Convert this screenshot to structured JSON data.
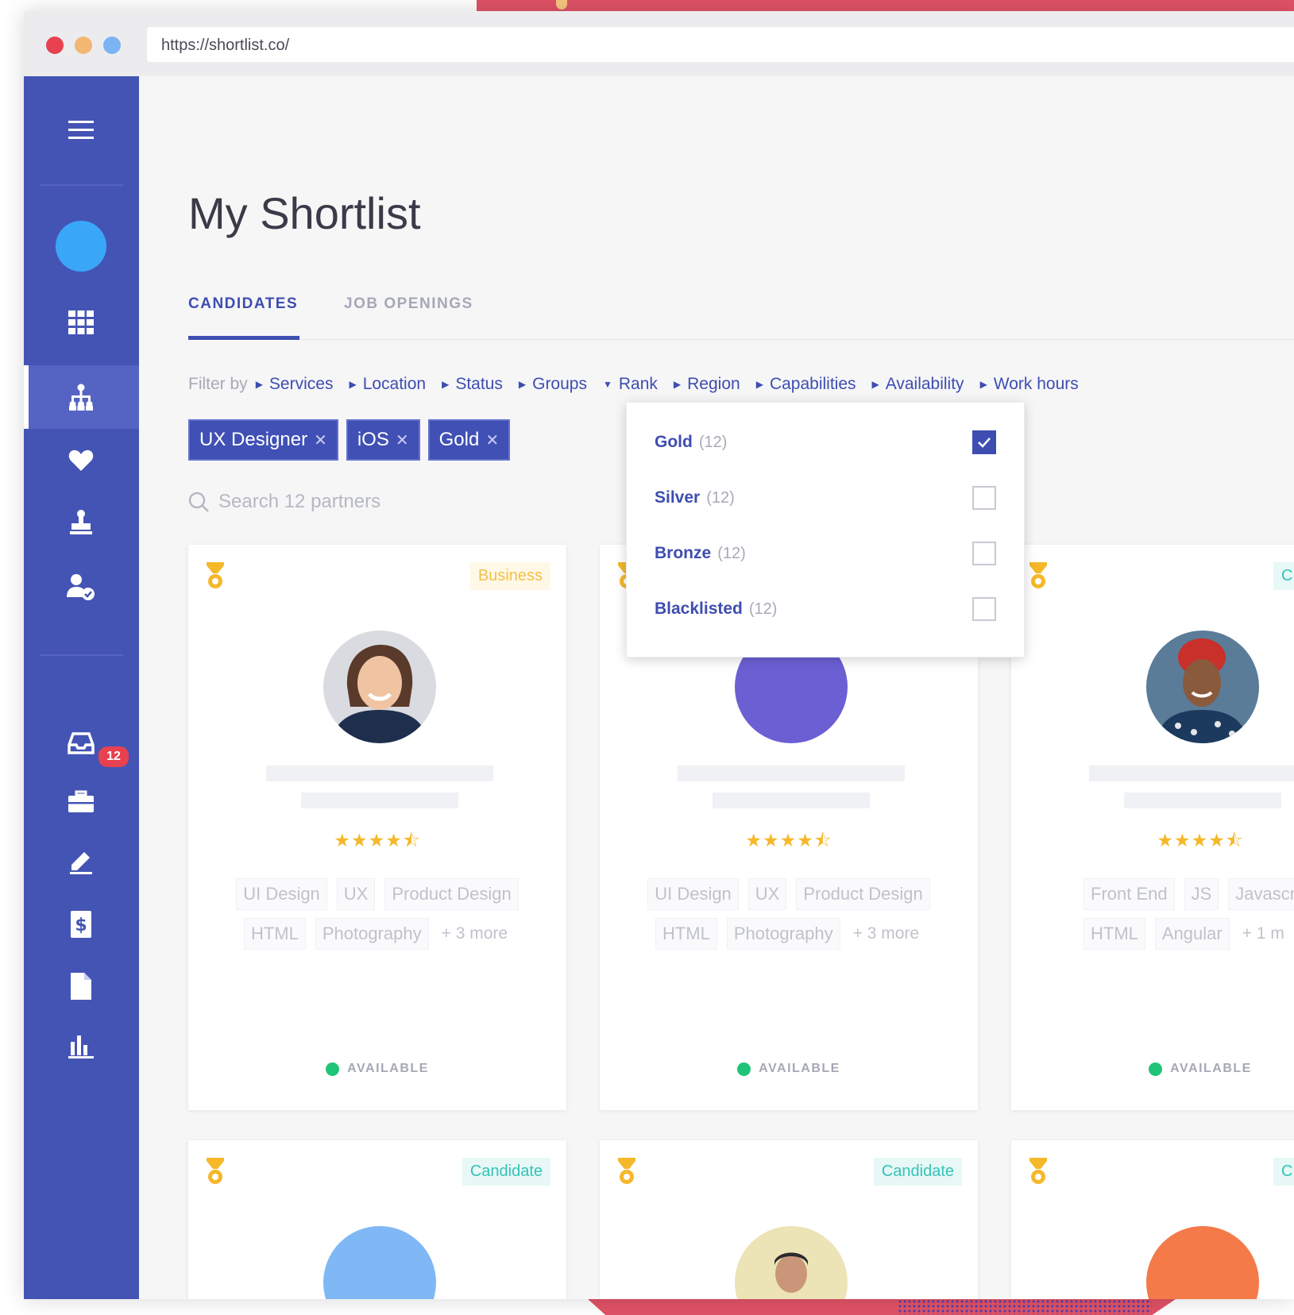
{
  "browser": {
    "url": "https://shortlist.co/"
  },
  "sidebar": {
    "notification_count": "12",
    "icons": [
      "menu-icon",
      "avatar",
      "grid-icon",
      "org-chart-icon",
      "heart-icon",
      "stamp-icon",
      "user-check-icon",
      "inbox-icon",
      "briefcase-icon",
      "pencil-icon",
      "dollar-document-icon",
      "file-icon",
      "bar-chart-icon"
    ]
  },
  "page": {
    "title": "My Shortlist"
  },
  "tabs": [
    {
      "label": "CANDIDATES",
      "active": true
    },
    {
      "label": "JOB OPENINGS",
      "active": false
    }
  ],
  "filters": {
    "label": "Filter by",
    "items": [
      "Services",
      "Location",
      "Status",
      "Groups",
      "Rank",
      "Region",
      "Capabilities",
      "Availability",
      "Work hours"
    ],
    "open_item": "Rank"
  },
  "chips": [
    "UX Designer",
    "iOS",
    "Gold"
  ],
  "search": {
    "placeholder": "Search 12 partners"
  },
  "rank_dropdown": {
    "options": [
      {
        "label": "Gold",
        "count": "(12)",
        "checked": true
      },
      {
        "label": "Silver",
        "count": "(12)",
        "checked": false
      },
      {
        "label": "Bronze",
        "count": "(12)",
        "checked": false
      },
      {
        "label": "Blacklisted",
        "count": "(12)",
        "checked": false
      }
    ]
  },
  "cards": [
    {
      "type": "Business",
      "rating": 4.5,
      "stars": "★★★★⯪",
      "tags_row1": [
        "UI Design",
        "UX",
        "Product Design"
      ],
      "tags_row2": [
        "HTML",
        "Photography"
      ],
      "more": "+ 3 more",
      "status": "AVAILABLE"
    },
    {
      "type": "",
      "rating": 4.5,
      "stars": "★★★★⯪",
      "tags_row1": [
        "UI Design",
        "UX",
        "Product Design"
      ],
      "tags_row2": [
        "HTML",
        "Photography"
      ],
      "more": "+ 3 more",
      "status": "AVAILABLE"
    },
    {
      "type": "C",
      "rating": 4.5,
      "stars": "★★★★⯪",
      "tags_row1": [
        "Front End",
        "JS",
        "Javascri"
      ],
      "tags_row2": [
        "HTML",
        "Angular"
      ],
      "more": "+ 1 m",
      "status": "AVAILABLE"
    }
  ],
  "cards_row2": [
    {
      "type": "Candidate"
    },
    {
      "type": "Candidate"
    },
    {
      "type": "C"
    }
  ],
  "colors": {
    "sidebar": "#4454b5",
    "accent": "#3e4db0",
    "available": "#1fc478",
    "star": "#f5b82a",
    "badge": "#e8414f"
  }
}
